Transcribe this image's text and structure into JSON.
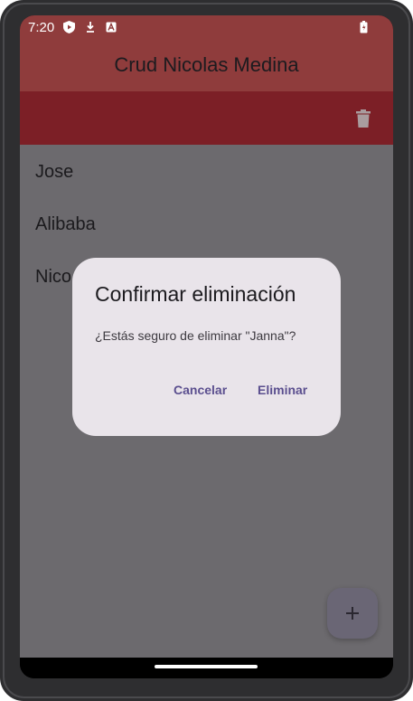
{
  "status_bar": {
    "time": "7:20",
    "icons": [
      "shield-play-icon",
      "download-arrow-icon",
      "a-notification-icon",
      "battery-icon"
    ]
  },
  "app_bar": {
    "title": "Crud Nicolas Medina"
  },
  "action_bar": {
    "delete_icon": "trash-icon"
  },
  "list": {
    "items": [
      {
        "name": "Jose"
      },
      {
        "name": "Alibaba"
      },
      {
        "name": "Nico"
      }
    ]
  },
  "dialog": {
    "title": "Confirmar eliminación",
    "message": "¿Estás seguro de eliminar \"Janna\"?",
    "cancel_label": "Cancelar",
    "confirm_label": "Eliminar"
  },
  "fab": {
    "icon": "plus-icon",
    "label": "+"
  },
  "colors": {
    "app_bar": "#8f3c3c",
    "action_bar": "#7c1f26",
    "scrim_content": "#6c6a6e",
    "dialog_surface": "#e9e4ea",
    "dialog_action": "#5b4f8f"
  }
}
